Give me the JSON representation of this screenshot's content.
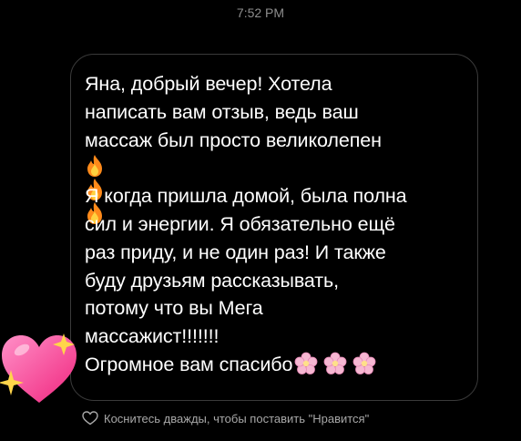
{
  "status": {
    "time": "7:52 PM"
  },
  "message": {
    "lines": [
      "Яна, добрый вечер! Хотела",
      "написать вам отзыв, ведь ваш",
      "массаж был просто великолепен",
      "Я когда пришла домой, была полна",
      "сил и энергии. Я обязательно ещё",
      "раз приду, и не один раз! И также",
      "буду друзьям рассказывать,",
      "потому что вы Мега",
      "массажист!!!!!!!",
      "Огромное вам спасибо"
    ],
    "emoji_row_icons": [
      "fire-emoji",
      "fire-emoji",
      "fire-emoji"
    ],
    "closing_icons": [
      "blossom-emoji",
      "blossom-emoji",
      "blossom-emoji"
    ]
  },
  "reaction_sticker": {
    "icon": "sparkling-heart-emoji"
  },
  "like_hint": {
    "icon": "heart-outline-icon",
    "text": "Коснитесь дважды, чтобы поставить \"Нравится\""
  },
  "colors": {
    "background": "#000000",
    "bubble_border": "#3a3a3a",
    "muted_text": "#8e8e8e",
    "heart": "#ff4fa3"
  }
}
